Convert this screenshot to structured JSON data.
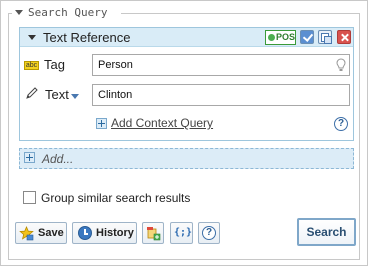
{
  "panel": {
    "legend": "Search Query"
  },
  "query": {
    "title": "Text Reference",
    "pos_label": "POS",
    "rows": {
      "tag": {
        "label": "Tag",
        "value": "Person"
      },
      "text": {
        "label": "Text",
        "value": "Clinton"
      }
    },
    "add_context_label": "Add Context Query",
    "help_label": "?"
  },
  "add": {
    "label": "Add..."
  },
  "options": {
    "group_label": "Group similar search results",
    "group_checked": false
  },
  "toolbar": {
    "save_label": "Save",
    "history_label": "History",
    "json_label": "{;}",
    "help_label": "?",
    "search_label": "Search"
  },
  "icons": {
    "collapse": "triangle-down-icon",
    "pos": "pos-toggle-icon",
    "check": "checkbox-checked-icon",
    "copy": "copy-icon",
    "close": "close-icon",
    "tag": "abc-icon",
    "text": "pen-icon",
    "bulb": "lightbulb-icon",
    "save": "star-icon",
    "history": "clock-icon",
    "add_query": "add-query-icon",
    "json": "json-braces-icon"
  },
  "colors": {
    "header_bg": "#d9ecf7",
    "border_blue": "#9ec6dd",
    "accent": "#2b6ab0",
    "close_red": "#d9534f"
  }
}
